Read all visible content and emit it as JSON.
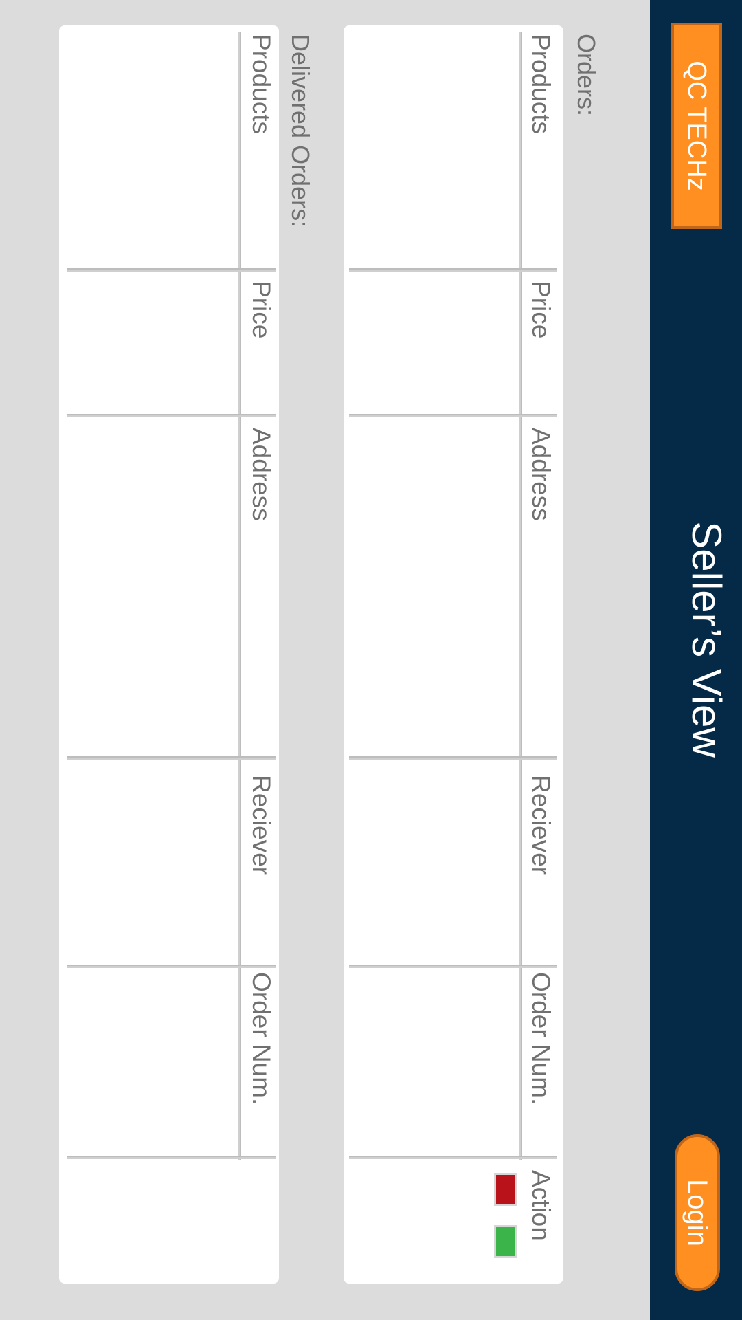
{
  "header": {
    "brand": "QC TECHz",
    "title": "Seller’s View",
    "login_label": "Login"
  },
  "orders": {
    "label": "Orders:",
    "columns": [
      "Products",
      "Price",
      "Address",
      "Reciever",
      "Order Num.",
      "Action"
    ],
    "rows": [],
    "actions": {
      "reject_color": "#b9121b",
      "accept_color": "#3bb54a"
    }
  },
  "delivered": {
    "label": "Delivered Orders:",
    "columns": [
      "Products",
      "Price",
      "Address",
      "Reciever",
      "Order Num."
    ],
    "rows": []
  },
  "colors": {
    "header_bg": "#052a47",
    "accent": "#ff8f21",
    "page_bg": "#dcdcdc"
  }
}
